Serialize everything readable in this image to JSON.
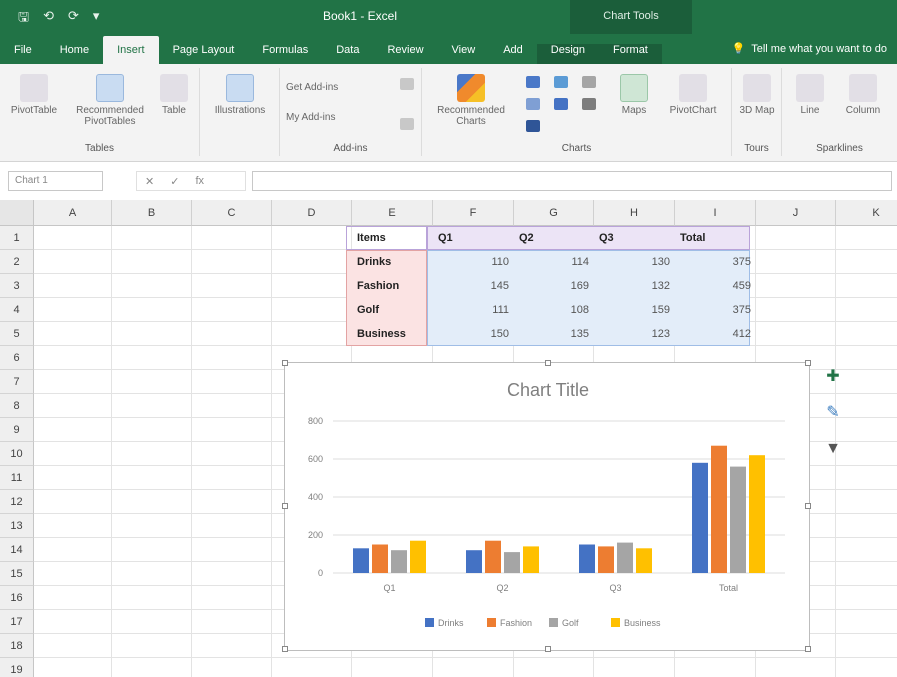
{
  "titlebar": {
    "qat": [
      "⟲",
      "⟳",
      "▾"
    ],
    "doc_title": "Book1 - Excel",
    "context_tab_group": "Chart Tools"
  },
  "tabs": [
    {
      "label": "File",
      "active": false
    },
    {
      "label": "Home",
      "active": false
    },
    {
      "label": "Insert",
      "active": true
    },
    {
      "label": "Page Layout",
      "active": false
    },
    {
      "label": "Formulas",
      "active": false
    },
    {
      "label": "Data",
      "active": false
    },
    {
      "label": "Review",
      "active": false
    },
    {
      "label": "View",
      "active": false
    },
    {
      "label": "Add",
      "active": false
    },
    {
      "label": "Design",
      "active": false,
      "context": true
    },
    {
      "label": "Format",
      "active": false,
      "context": true
    }
  ],
  "tellme": "Tell me what you want to do",
  "ribbon": {
    "groups": [
      {
        "label": "Tables",
        "buttons": [
          "PivotTable",
          "Recommended PivotTables",
          "Table"
        ]
      },
      {
        "label": "",
        "buttons": [
          "Illustrations"
        ]
      },
      {
        "label": "Add-ins",
        "buttons": [
          "Get Add-ins",
          "My Add-ins"
        ]
      },
      {
        "label": "Charts",
        "buttons": [
          "Recommended Charts",
          "Maps",
          "PivotChart"
        ]
      },
      {
        "label": "Tours",
        "buttons": [
          "3D Map"
        ]
      },
      {
        "label": "Sparklines",
        "buttons": [
          "Line",
          "Column"
        ]
      }
    ]
  },
  "formulabar": {
    "namebox": "Chart 1",
    "fx": [
      "✕",
      "✓",
      "fx"
    ]
  },
  "columns": [
    "A",
    "B",
    "C",
    "D",
    "E",
    "F",
    "G",
    "H",
    "I",
    "J",
    "K"
  ],
  "rows": [
    "1",
    "2",
    "3",
    "4",
    "5",
    "6",
    "7",
    "8",
    "9",
    "10",
    "11",
    "12",
    "13",
    "14",
    "15",
    "16",
    "17",
    "18",
    "19"
  ],
  "table": {
    "headers": [
      "Items",
      "Q1",
      "Q2",
      "Q3",
      "Total"
    ],
    "rows": [
      {
        "label": "Drinks",
        "values": [
          "110",
          "114",
          "130",
          "375"
        ]
      },
      {
        "label": "Fashion",
        "values": [
          "145",
          "169",
          "132",
          "459"
        ]
      },
      {
        "label": "Golf",
        "values": [
          "111",
          "108",
          "159",
          "375"
        ]
      },
      {
        "label": "Business",
        "values": [
          "150",
          "135",
          "123",
          "412"
        ]
      }
    ]
  },
  "chart_data": {
    "type": "bar",
    "title": "Chart Title",
    "categories": [
      "Q1",
      "Q2",
      "Q3",
      "Total"
    ],
    "series": [
      {
        "name": "Drinks",
        "values": [
          130,
          120,
          150,
          580
        ],
        "color": "#4472c4"
      },
      {
        "name": "Fashion",
        "values": [
          150,
          170,
          140,
          670
        ],
        "color": "#ed7d31"
      },
      {
        "name": "Golf",
        "values": [
          120,
          110,
          160,
          560
        ],
        "color": "#a5a5a5"
      },
      {
        "name": "Business",
        "values": [
          170,
          140,
          130,
          620
        ],
        "color": "#ffc000"
      }
    ],
    "yticks": [
      0,
      200,
      400,
      600,
      800
    ],
    "ylim": [
      0,
      800
    ],
    "grid": true,
    "legend": "bottom"
  },
  "side_tools": [
    {
      "name": "chart-elements-icon",
      "glyph": "✚",
      "color": "#217346"
    },
    {
      "name": "chart-styles-icon",
      "glyph": "✎",
      "color": "#3d7fc1"
    },
    {
      "name": "chart-filters-icon",
      "glyph": "▼",
      "color": "#555555"
    }
  ]
}
